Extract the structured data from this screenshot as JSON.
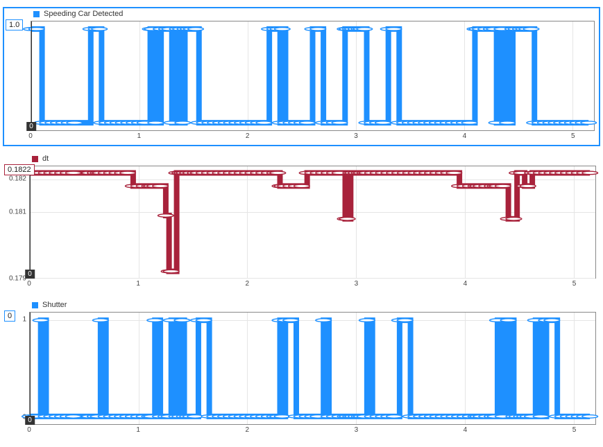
{
  "time_cursor": {
    "t": 0,
    "label": "0"
  },
  "xaxis": {
    "min": 0,
    "max": 5.2,
    "ticks": [
      0,
      1,
      2,
      3,
      4,
      5
    ]
  },
  "chart_data": [
    {
      "type": "line",
      "title": "Speeding Car Detected",
      "color": "#1e90ff",
      "interpolation": "step",
      "selected": true,
      "y": {
        "min": -0.08,
        "max": 1.08,
        "ticks": []
      },
      "cursor_value": "1.0",
      "x": [
        0.0,
        0.05,
        0.1,
        0.15,
        0.2,
        0.25,
        0.3,
        0.35,
        0.4,
        0.55,
        0.6,
        0.63,
        0.65,
        0.7,
        0.75,
        0.8,
        0.85,
        0.9,
        0.95,
        1.0,
        1.05,
        1.1,
        1.12,
        1.15,
        1.2,
        1.25,
        1.28,
        1.3,
        1.35,
        1.38,
        1.4,
        1.42,
        1.45,
        1.48,
        1.52,
        1.55,
        1.6,
        1.65,
        1.7,
        1.75,
        1.8,
        1.85,
        1.9,
        1.95,
        2.0,
        2.05,
        2.1,
        2.15,
        2.2,
        2.25,
        2.28,
        2.3,
        2.32,
        2.35,
        2.4,
        2.45,
        2.5,
        2.55,
        2.6,
        2.65,
        2.7,
        2.75,
        2.8,
        2.85,
        2.9,
        2.92,
        2.95,
        2.97,
        3.0,
        3.03,
        3.05,
        3.08,
        3.1,
        3.15,
        3.2,
        3.25,
        3.3,
        3.35,
        3.4,
        3.45,
        3.5,
        3.55,
        3.6,
        3.65,
        3.7,
        3.75,
        3.8,
        3.85,
        3.9,
        3.95,
        4.0,
        4.05,
        4.1,
        4.12,
        4.15,
        4.2,
        4.25,
        4.28,
        4.3,
        4.35,
        4.4,
        4.45,
        4.48,
        4.52,
        4.55,
        4.58,
        4.62,
        4.65,
        4.7,
        4.75,
        4.8,
        4.85,
        4.9,
        4.95,
        5.0,
        5.05,
        5.1,
        5.15
      ],
      "values": [
        1,
        1,
        0,
        0,
        0,
        0,
        0,
        0,
        0,
        1,
        1,
        1,
        0,
        0,
        0,
        0,
        0,
        0,
        0,
        0,
        0,
        1,
        1,
        0,
        1,
        1,
        1,
        0,
        1,
        1,
        0,
        1,
        1,
        1,
        1,
        0,
        0,
        0,
        0,
        0,
        0,
        0,
        0,
        0,
        0,
        0,
        0,
        0,
        1,
        1,
        1,
        0,
        1,
        0,
        0,
        0,
        0,
        0,
        1,
        1,
        0,
        0,
        0,
        0,
        1,
        1,
        1,
        1,
        1,
        1,
        1,
        1,
        0,
        0,
        0,
        0,
        1,
        1,
        0,
        0,
        0,
        0,
        0,
        0,
        0,
        0,
        0,
        0,
        0,
        0,
        0,
        0,
        1,
        1,
        1,
        1,
        1,
        1,
        0,
        1,
        0,
        1,
        1,
        1,
        1,
        1,
        1,
        0,
        0,
        0,
        0,
        0,
        0,
        0,
        0,
        0,
        0,
        0
      ]
    },
    {
      "type": "line",
      "title": "dt",
      "color": "#a8223b",
      "interpolation": "step",
      "selected": false,
      "y": {
        "min": 0.179,
        "max": 0.1824,
        "ticks": [
          0.179,
          0.181,
          0.182
        ]
      },
      "cursor_value": "0.1822",
      "x": [
        0.0,
        0.05,
        0.1,
        0.15,
        0.2,
        0.25,
        0.3,
        0.35,
        0.4,
        0.55,
        0.6,
        0.63,
        0.65,
        0.7,
        0.75,
        0.8,
        0.85,
        0.9,
        0.95,
        1.0,
        1.05,
        1.1,
        1.12,
        1.15,
        1.2,
        1.25,
        1.28,
        1.3,
        1.35,
        1.38,
        1.4,
        1.42,
        1.45,
        1.48,
        1.52,
        1.55,
        1.6,
        1.65,
        1.7,
        1.75,
        1.8,
        1.85,
        1.9,
        1.95,
        2.0,
        2.05,
        2.1,
        2.15,
        2.2,
        2.25,
        2.28,
        2.3,
        2.32,
        2.35,
        2.4,
        2.45,
        2.5,
        2.55,
        2.6,
        2.65,
        2.7,
        2.75,
        2.8,
        2.85,
        2.9,
        2.92,
        2.95,
        2.97,
        3.0,
        3.03,
        3.05,
        3.08,
        3.1,
        3.15,
        3.2,
        3.25,
        3.3,
        3.35,
        3.4,
        3.45,
        3.5,
        3.55,
        3.6,
        3.65,
        3.7,
        3.75,
        3.8,
        3.85,
        3.9,
        3.95,
        4.0,
        4.05,
        4.1,
        4.12,
        4.15,
        4.2,
        4.25,
        4.28,
        4.3,
        4.35,
        4.4,
        4.45,
        4.48,
        4.52,
        4.55,
        4.58,
        4.62,
        4.65,
        4.7,
        4.75,
        4.8,
        4.85,
        4.9,
        4.95,
        5.0,
        5.05,
        5.1,
        5.15
      ],
      "values": [
        0.1822,
        0.1822,
        0.1822,
        0.1822,
        0.1822,
        0.1822,
        0.1822,
        0.1822,
        0.1822,
        0.1822,
        0.1822,
        0.1822,
        0.1822,
        0.1822,
        0.1822,
        0.1822,
        0.1822,
        0.1822,
        0.1818,
        0.1818,
        0.1818,
        0.1818,
        0.1818,
        0.1818,
        0.1818,
        0.1809,
        0.1792,
        0.1792,
        0.1822,
        0.1822,
        0.1822,
        0.1822,
        0.1822,
        0.1822,
        0.1822,
        0.1822,
        0.1822,
        0.1822,
        0.1822,
        0.1822,
        0.1822,
        0.1822,
        0.1822,
        0.1822,
        0.1822,
        0.1822,
        0.1822,
        0.1822,
        0.1822,
        0.1822,
        0.1822,
        0.1818,
        0.1818,
        0.1818,
        0.1818,
        0.1818,
        0.1818,
        0.1822,
        0.1822,
        0.1822,
        0.1822,
        0.1822,
        0.1822,
        0.1822,
        0.1808,
        0.1808,
        0.1822,
        0.1822,
        0.1822,
        0.1822,
        0.1822,
        0.1822,
        0.1822,
        0.1822,
        0.1822,
        0.1822,
        0.1822,
        0.1822,
        0.1822,
        0.1822,
        0.1822,
        0.1822,
        0.1822,
        0.1822,
        0.1822,
        0.1822,
        0.1822,
        0.1822,
        0.1822,
        0.1818,
        0.1818,
        0.1818,
        0.1818,
        0.1818,
        0.1818,
        0.1818,
        0.1818,
        0.1818,
        0.1818,
        0.1818,
        0.1808,
        0.1808,
        0.1822,
        0.1822,
        0.1818,
        0.1818,
        0.1822,
        0.1822,
        0.1822,
        0.1822,
        0.1822,
        0.1822,
        0.1822,
        0.1822,
        0.1822,
        0.1822,
        0.1822,
        0.1822
      ]
    },
    {
      "type": "line",
      "title": "Shutter",
      "color": "#1e90ff",
      "interpolation": "step",
      "selected": false,
      "y": {
        "min": -0.08,
        "max": 1.08,
        "ticks": [
          0,
          1
        ]
      },
      "cursor_value": "0",
      "x": [
        0.0,
        0.05,
        0.1,
        0.15,
        0.2,
        0.25,
        0.3,
        0.35,
        0.4,
        0.55,
        0.6,
        0.63,
        0.65,
        0.7,
        0.75,
        0.8,
        0.85,
        0.9,
        0.95,
        1.0,
        1.05,
        1.1,
        1.12,
        1.15,
        1.2,
        1.25,
        1.28,
        1.3,
        1.35,
        1.38,
        1.4,
        1.42,
        1.45,
        1.48,
        1.52,
        1.55,
        1.6,
        1.65,
        1.7,
        1.75,
        1.8,
        1.85,
        1.9,
        1.95,
        2.0,
        2.05,
        2.1,
        2.15,
        2.2,
        2.25,
        2.28,
        2.3,
        2.32,
        2.35,
        2.4,
        2.45,
        2.5,
        2.55,
        2.6,
        2.65,
        2.7,
        2.75,
        2.8,
        2.85,
        2.9,
        2.92,
        2.95,
        2.97,
        3.0,
        3.03,
        3.05,
        3.08,
        3.1,
        3.15,
        3.2,
        3.25,
        3.3,
        3.35,
        3.4,
        3.45,
        3.5,
        3.55,
        3.6,
        3.65,
        3.7,
        3.75,
        3.8,
        3.85,
        3.9,
        3.95,
        4.0,
        4.05,
        4.1,
        4.12,
        4.15,
        4.2,
        4.25,
        4.28,
        4.3,
        4.35,
        4.4,
        4.45,
        4.48,
        4.52,
        4.55,
        4.58,
        4.62,
        4.65,
        4.7,
        4.75,
        4.8,
        4.85,
        4.9,
        4.95,
        5.0,
        5.05,
        5.1,
        5.15
      ],
      "values": [
        0,
        0,
        1,
        0,
        0,
        0,
        0,
        0,
        0,
        0,
        0,
        0,
        1,
        0,
        0,
        0,
        0,
        0,
        0,
        0,
        0,
        0,
        0,
        1,
        0,
        0,
        0,
        1,
        0,
        0,
        1,
        0,
        0,
        0,
        0,
        1,
        1,
        0,
        0,
        0,
        0,
        0,
        0,
        0,
        0,
        0,
        0,
        0,
        0,
        0,
        0,
        1,
        0,
        1,
        1,
        0,
        0,
        0,
        0,
        0,
        1,
        0,
        0,
        0,
        0,
        0,
        0,
        0,
        0,
        0,
        0,
        0,
        1,
        0,
        0,
        0,
        0,
        0,
        1,
        1,
        0,
        0,
        0,
        0,
        0,
        0,
        0,
        0,
        0,
        0,
        0,
        0,
        0,
        0,
        0,
        0,
        0,
        0,
        1,
        0,
        1,
        0,
        0,
        0,
        0,
        0,
        0,
        1,
        0,
        1,
        1,
        0,
        0,
        0,
        0,
        0,
        0,
        0
      ]
    }
  ]
}
